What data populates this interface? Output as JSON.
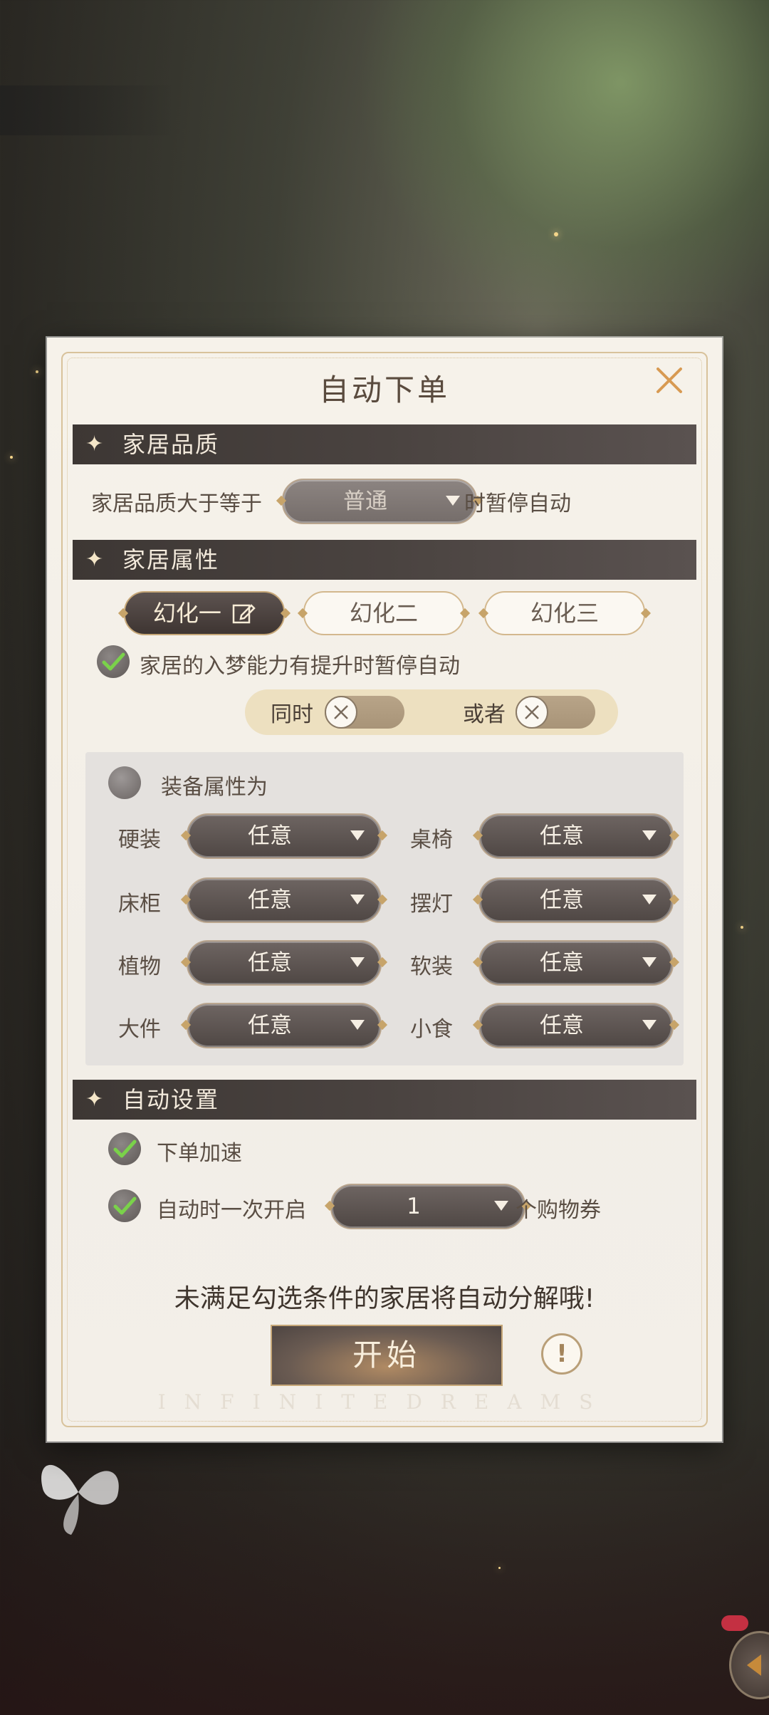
{
  "dialog": {
    "title": "自动下单",
    "close_icon": "close-icon"
  },
  "quality": {
    "header": "家居品质",
    "prefix": "家居品质大于等于",
    "dropdown_value": "普通",
    "suffix": "时暂停自动"
  },
  "attributes": {
    "header": "家居属性",
    "tabs": [
      {
        "label": "幻化一",
        "active": true
      },
      {
        "label": "幻化二",
        "active": false
      },
      {
        "label": "幻化三",
        "active": false
      }
    ],
    "edit_icon": "edit-icon",
    "dream_check_label": "家居的入梦能力有提升时暂停自动",
    "toggle_same_label": "同时",
    "toggle_or_label": "或者",
    "equip_label": "装备属性为",
    "equip_items": [
      {
        "label": "硬装",
        "value": "任意"
      },
      {
        "label": "桌椅",
        "value": "任意"
      },
      {
        "label": "床柜",
        "value": "任意"
      },
      {
        "label": "摆灯",
        "value": "任意"
      },
      {
        "label": "植物",
        "value": "任意"
      },
      {
        "label": "软装",
        "value": "任意"
      },
      {
        "label": "大件",
        "value": "任意"
      },
      {
        "label": "小食",
        "value": "任意"
      }
    ]
  },
  "auto": {
    "header": "自动设置",
    "speed_label": "下单加速",
    "open_prefix": "自动时一次开启",
    "open_value": "1",
    "open_suffix": "个购物券"
  },
  "footer": {
    "hint": "未满足勾选条件的家居将自动分解哦!",
    "start_label": "开始",
    "info_label": "!",
    "brand": "INFINITEDREAMS"
  },
  "colors": {
    "accent_gold": "#c7a46a",
    "bar_dark": "#3d3734",
    "panel_bg": "#f6f2ea"
  }
}
